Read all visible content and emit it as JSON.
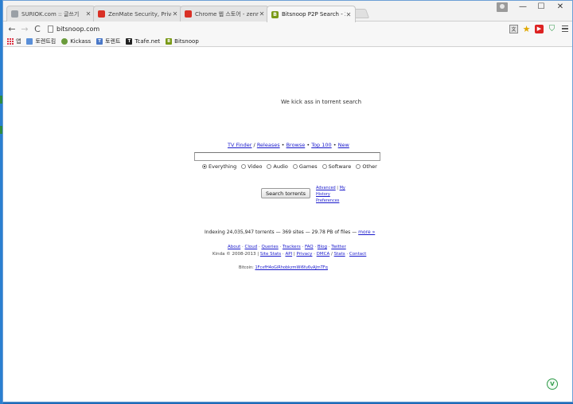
{
  "tabs": [
    {
      "label": "SURIOK.com :: 글쓰기",
      "favicon_color": "#9aa0a6",
      "active": false
    },
    {
      "label": "ZenMate Security, Privac",
      "favicon_color": "#d93025",
      "active": false
    },
    {
      "label": "Chrome 웹 스토어 - zenr",
      "favicon_color": "#d93025",
      "active": false
    },
    {
      "label": "Bitsnoop P2P Search - 2s",
      "favicon_color": "#7a9a18",
      "active": true
    }
  ],
  "toolbar": {
    "back_icon": "←",
    "forward_icon": "→",
    "reload_icon": "C",
    "url": "bitsnoop.com"
  },
  "window_controls": {
    "minimize": "—",
    "maximize": "☐",
    "close": "✕"
  },
  "bookmarks": [
    {
      "label": "앱",
      "icon": "apps-icon",
      "color": "#d33"
    },
    {
      "label": "토렌트킴",
      "icon": "folder-icon",
      "color": "#5a8fd8"
    },
    {
      "label": "Kickass",
      "icon": "kickass-icon",
      "color": "#6a9b3b"
    },
    {
      "label": "토렌트",
      "icon": "torrent-icon",
      "color": "#4a78c8"
    },
    {
      "label": "Tcafe.net",
      "icon": "tcafe-icon",
      "color": "#222222"
    },
    {
      "label": "Bitsnoop",
      "icon": "bitsnoop-icon",
      "color": "#7a9a18"
    }
  ],
  "page": {
    "tagline": "We kick ass in torrent search",
    "nav": [
      "TV Finder",
      "Releases",
      "Browse",
      "Top 100",
      "New"
    ],
    "nav_separators": [
      " / ",
      " • ",
      " • ",
      " • "
    ],
    "radio_options": [
      "Everything",
      "Video",
      "Audio",
      "Games",
      "Software",
      "Other"
    ],
    "selected_radio": "Everything",
    "search_button": "Search torrents",
    "advanced_links": [
      "Advanced",
      "My",
      "History",
      "Preferences"
    ],
    "indexing_text": "Indexing 24,035,947 torrents — 369 sites — 29.78 PB of files —",
    "indexing_more": "more »",
    "footer_links_row1": [
      "About",
      "Cloud",
      "Queries",
      "Trackers",
      "FAQ",
      "Blog",
      "Twitter"
    ],
    "footer_copyright": "Kinda © 2008-2013",
    "footer_links_row2": [
      "Site Stats",
      "API",
      "Privacy",
      "DMCA",
      "Stats",
      "Contact"
    ],
    "bitcoin_label": "Bitcoin:",
    "bitcoin_address": "1FcxfH4oGiRhobkzmWi6fu6vAJmTFq"
  }
}
